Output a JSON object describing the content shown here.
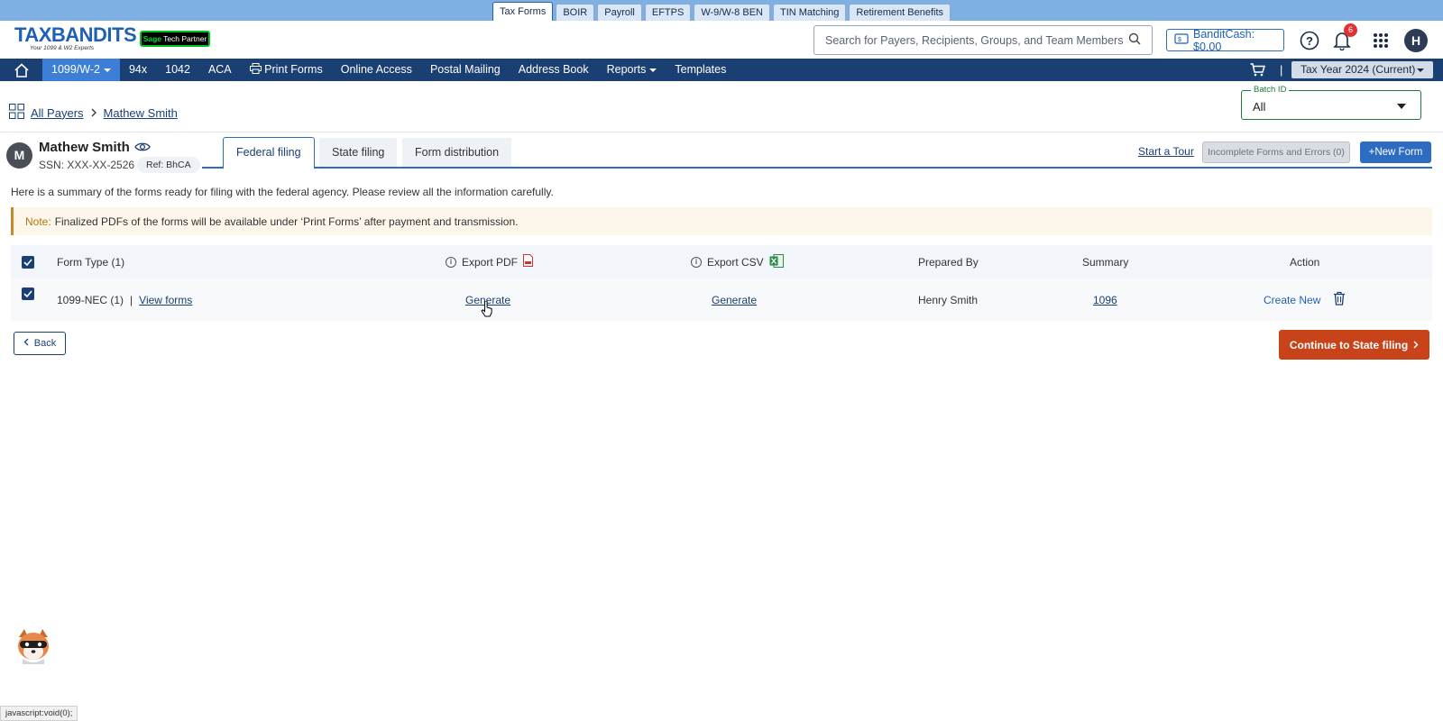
{
  "product_tabs": [
    "Tax Forms",
    "BOIR",
    "Payroll",
    "EFTPS",
    "W-9/W-8 BEN",
    "TIN Matching",
    "Retirement Benefits"
  ],
  "header": {
    "logo_text": "TAXBANDITS",
    "logo_tagline": "Your 1099 & W2 Experts",
    "partner_badge": {
      "brand": "Sage",
      "label": "Tech Partner"
    },
    "search_placeholder": "Search for Payers, Recipients, Groups, and Team Members",
    "bandit_cash": "BanditCash: $0.00",
    "notification_count": "6",
    "user_initial": "H"
  },
  "main_nav": {
    "items": [
      "1099/W-2",
      "94x",
      "1042",
      "ACA",
      "Print Forms",
      "Online Access",
      "Postal Mailing",
      "Address Book",
      "Reports",
      "Templates"
    ],
    "tax_year": "Tax Year 2024 (Current)"
  },
  "breadcrumb": {
    "all_payers": "All Payers",
    "payer": "Mathew Smith"
  },
  "batch": {
    "label": "Batch ID",
    "value": "All"
  },
  "payer": {
    "initial": "M",
    "name": "Mathew Smith",
    "ssn": "SSN: XXX-XX-2526",
    "ref": "Ref: BhCA"
  },
  "filing_tabs": [
    "Federal filing",
    "State filing",
    "Form distribution"
  ],
  "actions": {
    "start_tour": "Start a Tour",
    "incomplete": "Incomplete Forms and Errors (0)",
    "new_form": "New Form"
  },
  "summary_text": "Here is a summary of the forms ready for filing with the federal agency. Please review all the information carefully.",
  "note": {
    "label": "Note:",
    "text": "Finalized PDFs of the forms will be available under ‘Print Forms’ after payment and transmission."
  },
  "table": {
    "headers": {
      "form_type": "Form Type  (1)",
      "export_pdf": "Export PDF",
      "export_csv": "Export CSV",
      "prepared_by": "Prepared By",
      "summary": "Summary",
      "action": "Action"
    },
    "rows": [
      {
        "form_type": "1099-NEC (1)",
        "view_forms": "View forms",
        "export_pdf": "Generate",
        "export_csv": "Generate",
        "prepared_by": "Henry Smith",
        "summary": "1096",
        "action": "Create New"
      }
    ]
  },
  "buttons": {
    "back": "Back",
    "continue": "Continue to State filing"
  },
  "status_bar": "javascript:void(0);",
  "colors": {
    "nav_bg": "#1a3f73",
    "accent": "#2d6cc0",
    "continue": "#c9431a",
    "note_border": "#c48a2c"
  }
}
